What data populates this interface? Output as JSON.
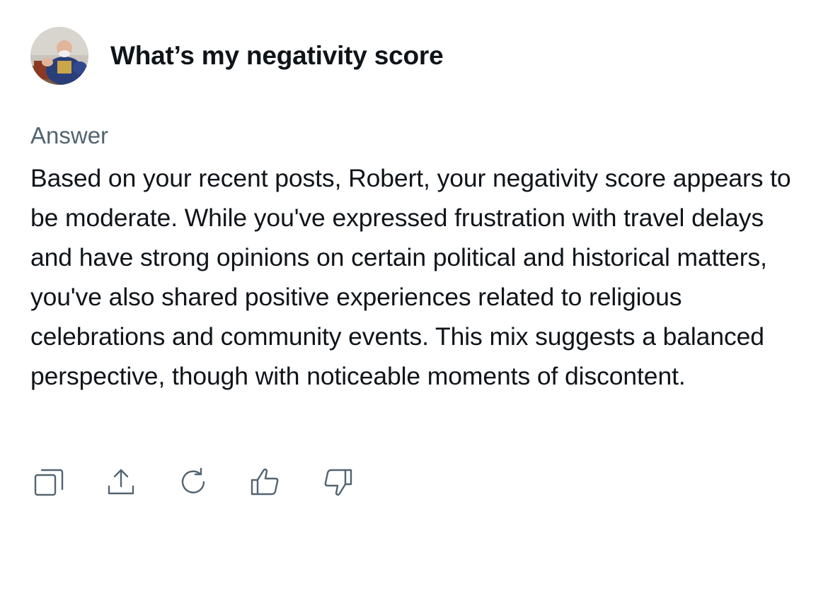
{
  "question": {
    "text": "What’s my negativity score"
  },
  "answer": {
    "label": "Answer",
    "text": "Based on your recent posts, Robert, your negativity score appears to be moderate. While you've expressed frustration with travel delays and have strong opinions on certain political and historical matters, you've also shared positive experiences related to religious celebrations and community events. This mix suggests a balanced perspective, though with noticeable moments of discontent."
  },
  "actions": [
    {
      "icon": "copy-icon"
    },
    {
      "icon": "share-icon"
    },
    {
      "icon": "regenerate-icon"
    },
    {
      "icon": "thumbs-up-icon"
    },
    {
      "icon": "thumbs-down-icon"
    }
  ],
  "colors": {
    "text_primary": "#0f1419",
    "text_secondary": "#536471",
    "background": "#ffffff"
  }
}
